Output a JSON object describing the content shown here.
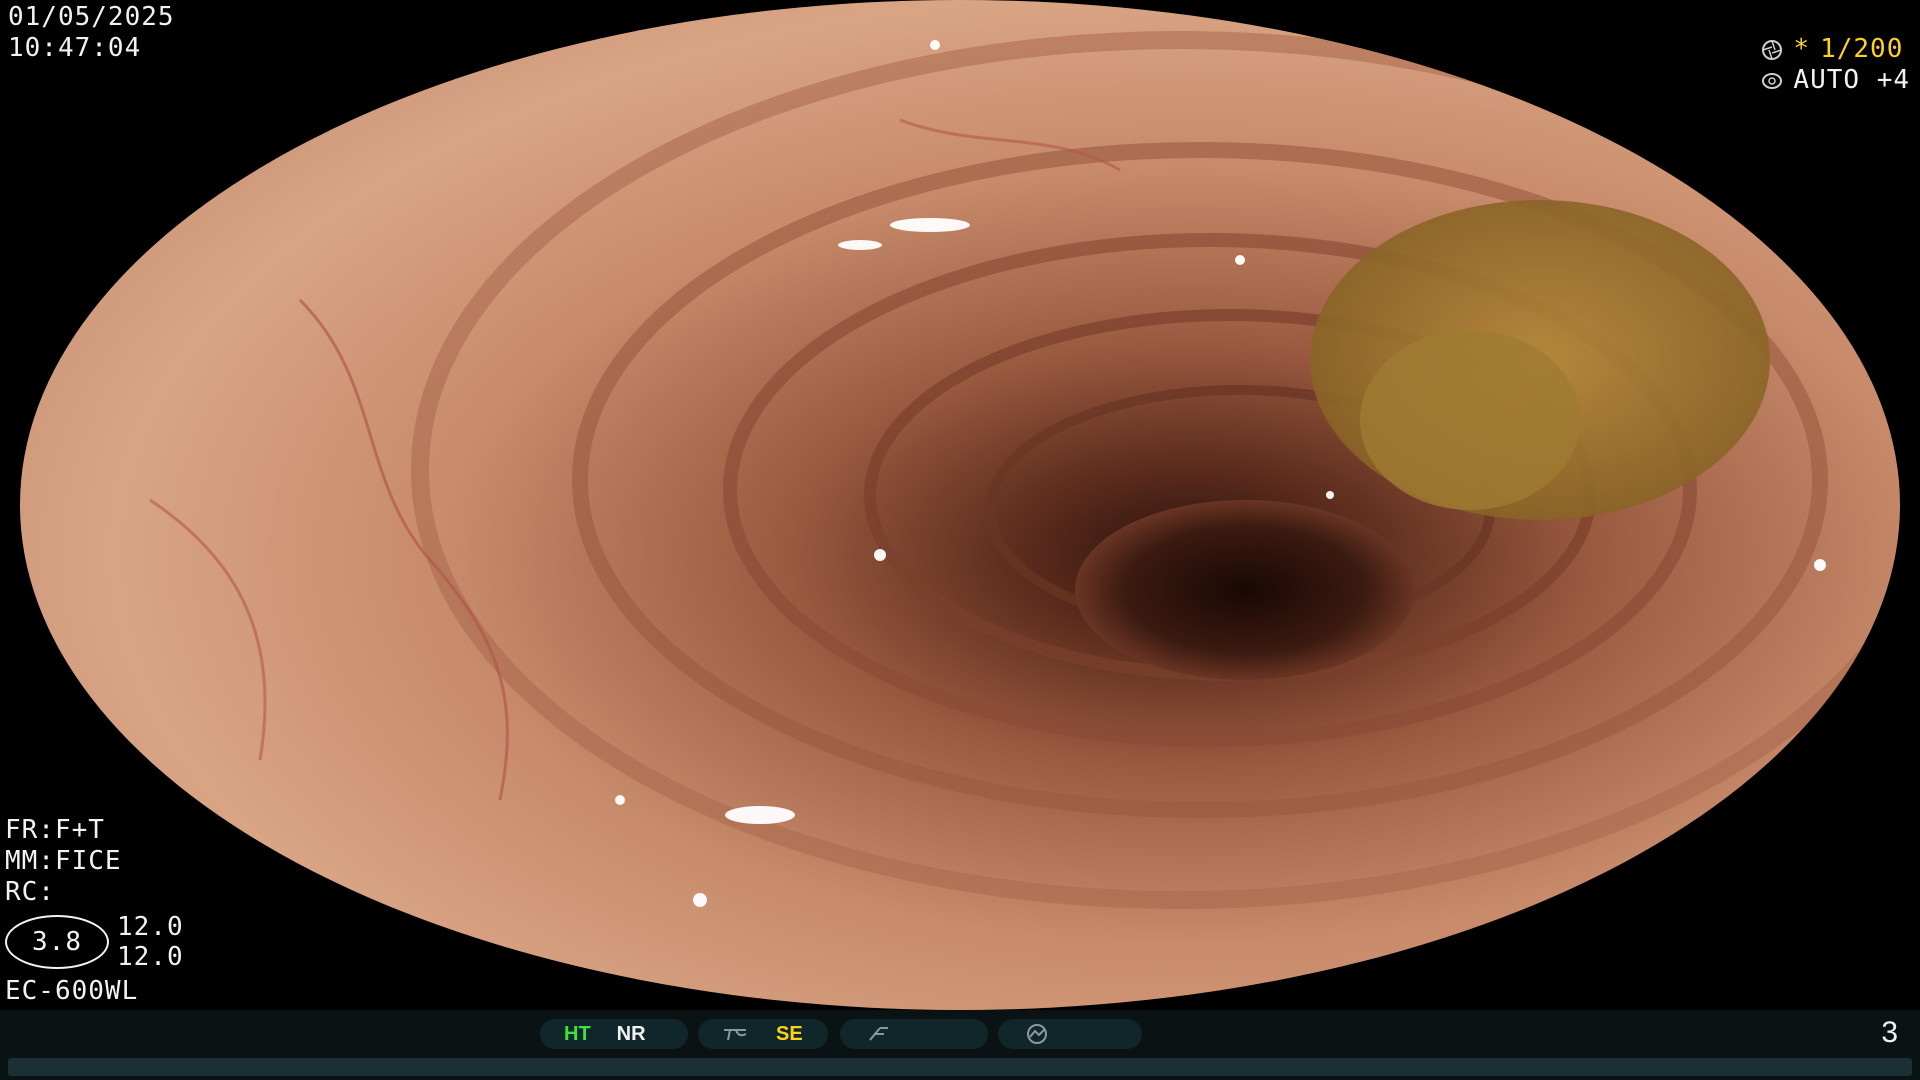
{
  "osd": {
    "date": "01/05/2025",
    "time": "10:47:04",
    "shutter": "1/200",
    "shutter_marker": "*",
    "iris": "AUTO +4",
    "fr": "FR:F+T",
    "mm": "MM:FICE",
    "rc": "RC:",
    "zoom": "3.8",
    "value_top": "12.0",
    "value_bottom": "12.0",
    "scope_model": "EC-600WL"
  },
  "statusbar": {
    "ht": "HT",
    "nr": "NR",
    "se": "SE",
    "page": "3"
  },
  "colors": {
    "ht": "#3fe03f",
    "se": "#ffd21a",
    "text": "#f2f2f2",
    "bar": "#11262a"
  },
  "icons": [
    "shutter-icon",
    "iris-icon",
    "structure-enhance-icon",
    "freeze-icon",
    "record-icon"
  ]
}
